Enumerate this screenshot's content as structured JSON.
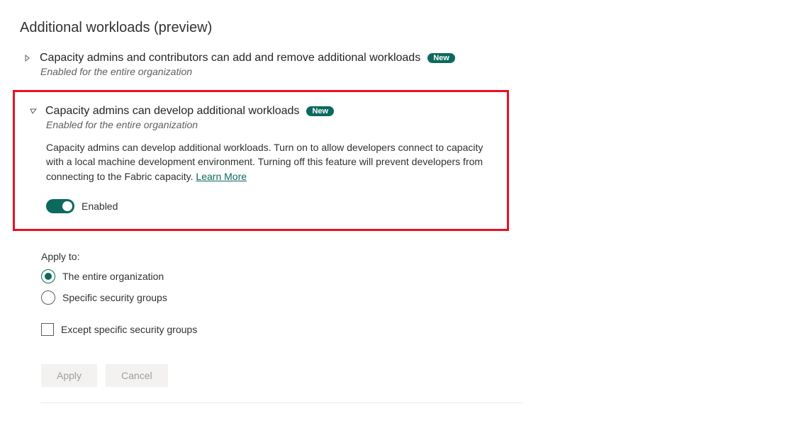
{
  "section_title": "Additional workloads (preview)",
  "settings": [
    {
      "title": "Capacity admins and contributors can add and remove additional workloads",
      "badge": "New",
      "status": "Enabled for the entire organization"
    },
    {
      "title": "Capacity admins can develop additional workloads",
      "badge": "New",
      "status": "Enabled for the entire organization",
      "description": "Capacity admins can develop additional workloads. Turn on to allow developers connect to capacity with a local machine development environment. Turning off this feature will prevent developers from connecting to the Fabric capacity.  ",
      "learn_more": "Learn More",
      "toggle_label": "Enabled",
      "toggle_on": true
    }
  ],
  "apply_to": {
    "label": "Apply to:",
    "options": [
      {
        "label": "The entire organization",
        "selected": true
      },
      {
        "label": "Specific security groups",
        "selected": false
      }
    ],
    "except_label": "Except specific security groups",
    "except_checked": false
  },
  "buttons": {
    "apply": "Apply",
    "cancel": "Cancel"
  }
}
